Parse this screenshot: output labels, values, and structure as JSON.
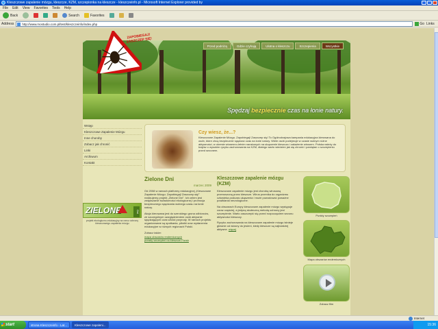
{
  "window": {
    "title": "Kleszczowe zapalenie mózgu, kleszcze, KZM, szczepionka na kleszcze - kleszczeinfo.pl - Microsoft Internet Explorer provided by"
  },
  "menu": [
    "File",
    "Edit",
    "View",
    "Favorites",
    "Tools",
    "Help"
  ],
  "toolbar": {
    "back": "Back",
    "search": "Search",
    "favorites": "Favorites"
  },
  "address": {
    "label": "Address",
    "url": "http://www.mostudio.com.pl/test/kleszczeinfo/index.php",
    "go": "Go",
    "links": "Links"
  },
  "site": {
    "top_nav": [
      {
        "label": "Przed podróżą"
      },
      {
        "label": "Gdzie czyhają"
      },
      {
        "label": "Ulotna o kleszczu"
      },
      {
        "label": "Szczepienia"
      },
      {
        "label": "Wszystkie",
        "active": true
      }
    ],
    "logo_text": "ZAPOBIEGAJ! ZASZCZEP SIĘ!",
    "slogan_pre": "Spędzaj ",
    "slogan_hl": "bezpiecznie",
    "slogan_post": " czas na łonie natury.",
    "left_nav": [
      "Wstęp",
      "Kleszczowe Zapalenie Mózgu",
      "Inne choroby",
      "Zobacz jak chronić",
      "Linki",
      "Archiwum",
      "Kontakt"
    ],
    "zielone": {
      "text": "ZIELONE",
      "side": "Dni",
      "caption": "projekt ekologiczno-edukacyjny na rzecz ochrony kleszczowego zapalenia mózgu"
    },
    "didyouknow": {
      "title": "Czy wiesz, że...?",
      "body": "Kleszczowe Zapalenie Mózgu. Zapobiegaj! Zaszczep się! To Ogólnokrajowa kampania edukacyjna kierowana do osób, które chcą bezpiecznie spędzać czas na łonie natury. Wiele osób podejmuje w czasie wolnym różne aktywności, w okresie wiosenno-letnim narażonych na ukąszenie kleszcza i zakażenie wirusem. Polska należy do krajów o wysokim ryzyku zachorowania na KZM, dlatego warto wiedzieć jak się chronić i pamiętać o szczepieniu przed sezonem."
    },
    "zielone_dni": {
      "title": "Zielone Dni",
      "date": "marzec 2009",
      "p1": "Od 2008 w ramach platformy edukacyjnej „Kleszczowe Zapalenie Mózgu. Zapobiegaj! Zaszczep się!” realizujemy projekt „Zielone Dni”. Ich celem jest zwiększanie świadomości ekologicznej i promocja bezpiecznego spędzania wolnego czasu na łonie natury.",
      "p2": "Akcja kierowana jest do szerokiego grona odbiorców, ze szczególnym uwzględnieniem osób aktywnie spędzających czas wśród przyrody. W ramach projektu organizowane są spotkania, pikniki oraz wydarzenia edukacyjne w różnych regionach Polski.",
      "links_label": "Zobacz także:",
      "link1": "mapa obszarów endemicznych",
      "link2": "porady szczepień na kleszcze Porstr"
    },
    "kzm": {
      "title": "Kleszczowe zapalenie mózgu (KZM)",
      "p1": "Kleszczowe zapalenie mózgu jest chorobą wirusową przenoszoną przez kleszcze. Wirus przenika do organizmu człowieka podczas ukąszenia i może powodować poważne powikłania neurologiczne.",
      "p2": "Na obszarach Europy kleszczowe zapalenie mózgu występuje coraz częściej, a jedyną skuteczną metodą ochrony jest szczepienie. Warto zaszczepić się przed rozpoczęciem sezonu aktywności kleszczy.",
      "p3": "Ryzyko zachorowania na kleszczowe zapalenie mózgu istnieje głównie od wiosny do jesieni, kiedy kleszcze są najbardziej aktywne.",
      "more": "więcej"
    },
    "widgets": [
      {
        "label": "Punkty szczepień"
      },
      {
        "label": "Mapa obszarów endemicznych"
      },
      {
        "label": "Zobacz film"
      }
    ]
  },
  "status": {
    "zone": "Internet"
  },
  "taskbar": {
    "start": "start",
    "tasks": [
      "strona Kleszczeinfo - Lat...",
      "Kleszczowe zapaleni..."
    ],
    "clock": "15:36"
  },
  "colors": {
    "accent": "#5a7a1a",
    "header_green": "#3d6b1f",
    "warning_red": "#d01010",
    "highlight": "#f5e24a"
  }
}
